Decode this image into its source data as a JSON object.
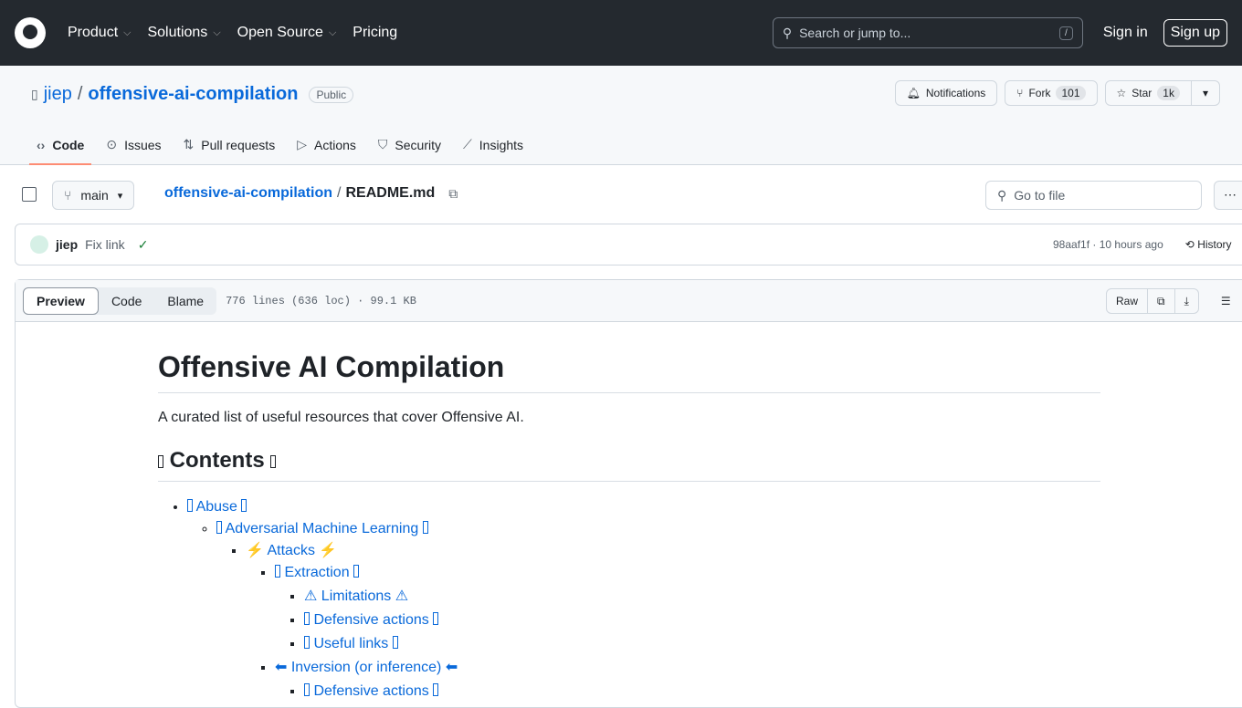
{
  "header": {
    "nav": [
      "Product",
      "Solutions",
      "Open Source",
      "Pricing"
    ],
    "search_placeholder": "Search or jump to...",
    "slash": "/",
    "sign_in": "Sign in",
    "sign_up": "Sign up"
  },
  "repo": {
    "owner": "jiep",
    "name": "offensive-ai-compilation",
    "visibility": "Public",
    "notifications": "Notifications",
    "fork": "Fork",
    "fork_count": "101",
    "star": "Star",
    "star_count": "1k"
  },
  "tabs": [
    "Code",
    "Issues",
    "Pull requests",
    "Actions",
    "Security",
    "Insights"
  ],
  "filebar": {
    "branch": "main",
    "path_repo": "offensive-ai-compilation",
    "sep": "/",
    "file": "README.md",
    "goto": "Go to file"
  },
  "commit": {
    "author": "jiep",
    "message": "Fix link",
    "sha": "98aaf1f",
    "time": "10 hours ago",
    "history": "History"
  },
  "file": {
    "views": [
      "Preview",
      "Code",
      "Blame"
    ],
    "info": "776 lines (636 loc) · 99.1 KB",
    "raw": "Raw"
  },
  "readme": {
    "title": "Offensive AI Compilation",
    "description": "A curated list of useful resources that cover Offensive AI.",
    "contents": "Contents",
    "toc": {
      "abuse": "Abuse",
      "aml": "Adversarial Machine Learning",
      "attacks": "⚡ Attacks ⚡",
      "extraction": "Extraction",
      "limitations": "⚠ Limitations ⚠",
      "defensive": "Defensive actions",
      "useful": "Useful links",
      "inversion": "⬅ Inversion (or inference) ⬅",
      "defensive2": "Defensive actions"
    }
  }
}
